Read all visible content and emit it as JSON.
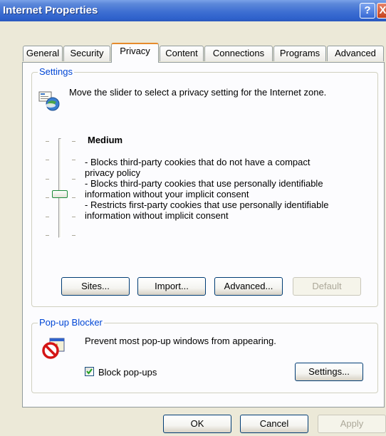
{
  "window": {
    "title": "Internet Properties",
    "help_label": "?",
    "close_label": "X"
  },
  "tabs": [
    {
      "label": "General"
    },
    {
      "label": "Security"
    },
    {
      "label": "Privacy"
    },
    {
      "label": "Content"
    },
    {
      "label": "Connections"
    },
    {
      "label": "Programs"
    },
    {
      "label": "Advanced"
    }
  ],
  "active_tab": "Privacy",
  "settings": {
    "group_title": "Settings",
    "intro": "Move the slider to select a privacy setting for the Internet zone.",
    "level": "Medium",
    "slider_level_index": 2,
    "slider_level_count": 6,
    "description_lines": [
      "- Blocks third-party cookies that do not have a compact",
      "privacy policy",
      "- Blocks third-party cookies that use personally identifiable",
      "information without your implicit consent",
      "- Restricts first-party cookies that use personally identifiable",
      "information without implicit consent"
    ],
    "buttons": {
      "sites": "Sites...",
      "import": "Import...",
      "advanced": "Advanced...",
      "default": "Default"
    }
  },
  "popup": {
    "group_title": "Pop-up Blocker",
    "description": "Prevent most pop-up windows from appearing.",
    "checkbox_label": "Block pop-ups",
    "checkbox_checked": true,
    "settings_button": "Settings..."
  },
  "footer": {
    "ok": "OK",
    "cancel": "Cancel",
    "apply": "Apply"
  }
}
